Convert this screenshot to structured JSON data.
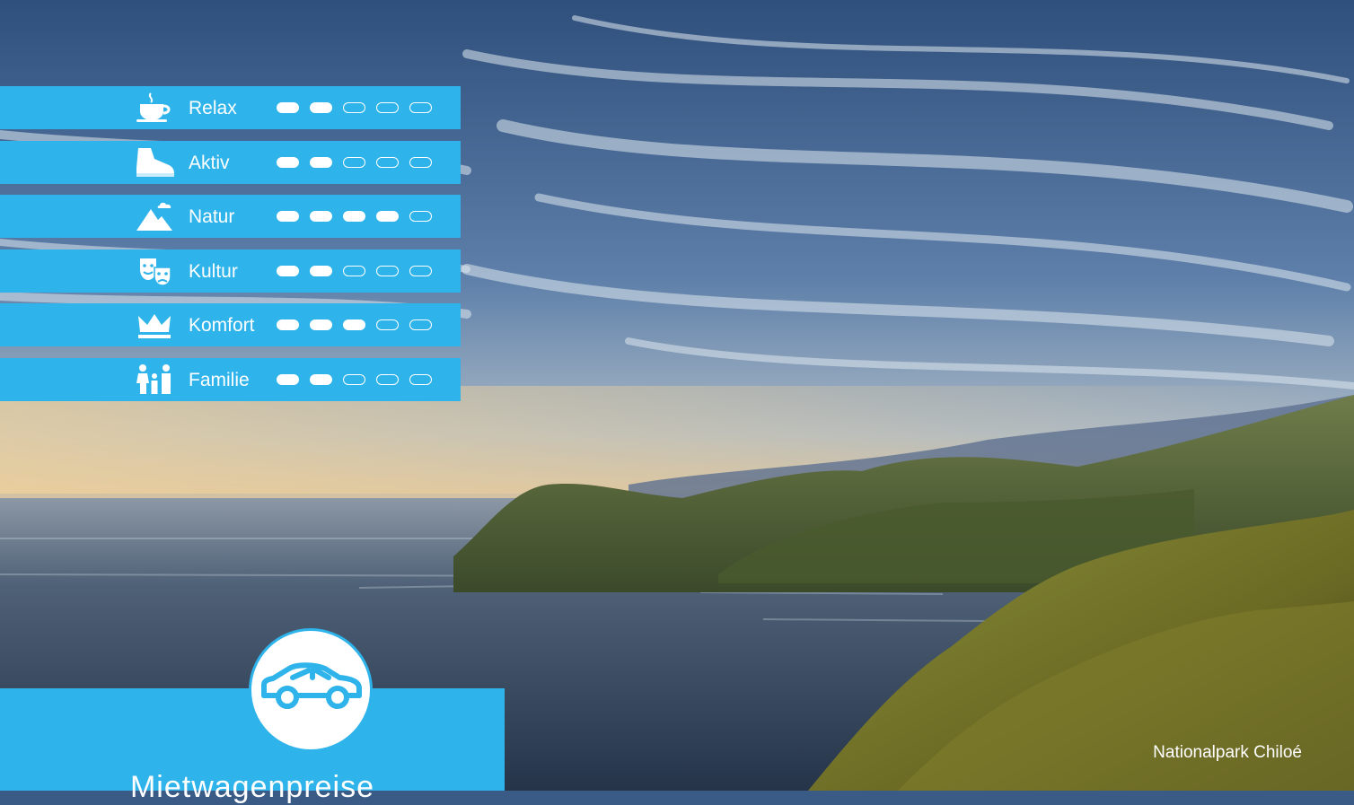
{
  "ratings": [
    {
      "label": "Relax",
      "icon": "coffee-cup-icon",
      "score": 2,
      "max": 5
    },
    {
      "label": "Aktiv",
      "icon": "hiking-boot-icon",
      "score": 2,
      "max": 5
    },
    {
      "label": "Natur",
      "icon": "mountain-icon",
      "score": 4,
      "max": 5
    },
    {
      "label": "Kultur",
      "icon": "theater-masks-icon",
      "score": 2,
      "max": 5
    },
    {
      "label": "Komfort",
      "icon": "crown-icon",
      "score": 3,
      "max": 5
    },
    {
      "label": "Familie",
      "icon": "family-icon",
      "score": 2,
      "max": 5
    }
  ],
  "rental": {
    "title": "Mietwagenpreise",
    "icon": "car-icon"
  },
  "photo": {
    "caption": "Nationalpark Chiloé"
  },
  "colors": {
    "accent": "#2eb3ea",
    "text": "#ffffff"
  }
}
